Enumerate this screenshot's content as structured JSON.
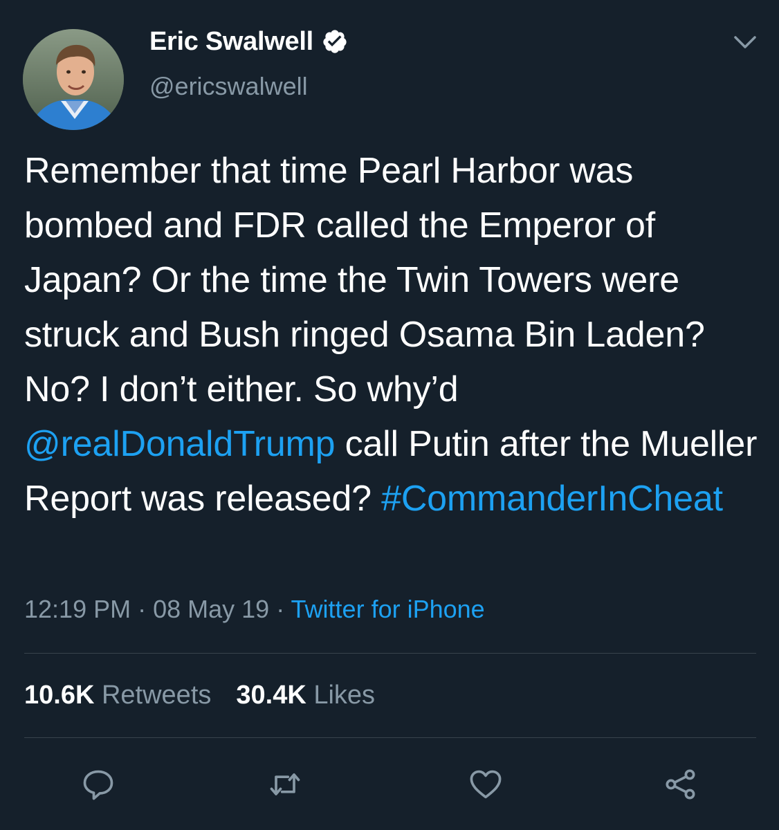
{
  "author": {
    "display_name": "Eric Swalwell",
    "handle": "@ericswalwell",
    "verified": true
  },
  "tweet": {
    "segments": [
      {
        "text": "Remember that time Pearl Harbor was bombed and FDR called the Emperor of Japan? Or the time the Twin Towers were struck and Bush ringed Osama Bin Laden? No? I don’t either. So why’d ",
        "type": "text"
      },
      {
        "text": "@realDonaldTrump",
        "type": "mention"
      },
      {
        "text": " call Putin after the Mueller Report was released? ",
        "type": "text"
      },
      {
        "text": "#CommanderInCheat",
        "type": "hashtag"
      }
    ]
  },
  "meta": {
    "time": "12:19 PM",
    "separator": " · ",
    "date": "08 May 19",
    "source": "Twitter for iPhone"
  },
  "stats": {
    "retweets_count": "10.6K",
    "retweets_label": "Retweets",
    "likes_count": "30.4K",
    "likes_label": "Likes"
  },
  "actions": {
    "reply_icon": "reply-icon",
    "retweet_icon": "retweet-icon",
    "like_icon": "heart-icon",
    "share_icon": "share-icon"
  },
  "colors": {
    "background": "#15202b",
    "link": "#1da1f2",
    "secondary_text": "#8899a6",
    "divider": "#38444d"
  }
}
